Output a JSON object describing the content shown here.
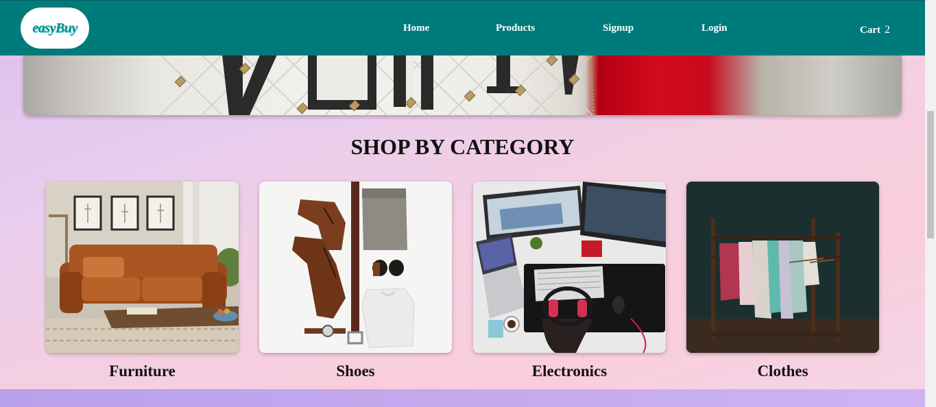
{
  "navbar": {
    "logo_text": "easyBuy",
    "links": [
      {
        "label": "Home"
      },
      {
        "label": "Products"
      },
      {
        "label": "Signup"
      },
      {
        "label": "Login"
      }
    ],
    "cart_label": "Cart",
    "cart_count": "2",
    "color": "#007b7c"
  },
  "section": {
    "title": "SHOP BY CATEGORY"
  },
  "categories": [
    {
      "label": "Furniture",
      "image": "leather-sofa-living-room"
    },
    {
      "label": "Shoes",
      "image": "boots-belt-clothes-flatlay"
    },
    {
      "label": "Electronics",
      "image": "computers-desk-headphones"
    },
    {
      "label": "Clothes",
      "image": "clothing-rack"
    }
  ]
}
